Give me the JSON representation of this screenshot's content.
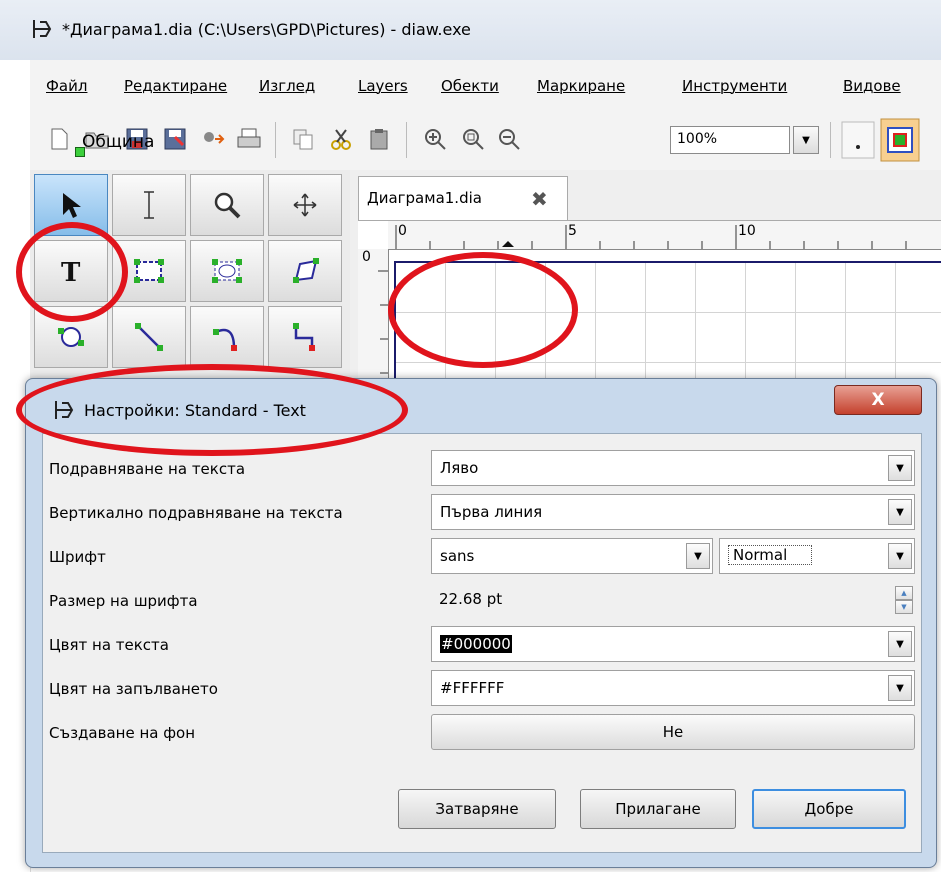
{
  "window": {
    "title": "*Диаграма1.dia (C:\\Users\\GPD\\Pictures) - diaw.exe"
  },
  "menu": [
    "Файл",
    "Редактиране",
    "Изглед",
    "Layers",
    "Обекти",
    "Маркиране",
    "Инструменти",
    "Видове"
  ],
  "toolbar": {
    "icons": [
      "new-file-icon",
      "open-folder-icon",
      "save-icon",
      "save-as-icon",
      "export-icon",
      "print-icon",
      "copy-icon",
      "cut-icon",
      "paste-icon",
      "zoom-in-icon",
      "zoom-fit-icon",
      "zoom-out-icon"
    ],
    "zoom_value": "100%"
  },
  "toolbox": {
    "tools": [
      "pointer-tool",
      "text-edit-tool",
      "magnify-tool",
      "move-tool",
      "text-tool",
      "box-tool",
      "ellipse-tool",
      "polygon-tool",
      "bezier-tool",
      "line-tool",
      "arc-tool",
      "zigzag-tool"
    ]
  },
  "document": {
    "tab_label": "Диаграма1.dia",
    "ruler_h": [
      "0",
      "5",
      "10"
    ],
    "ruler_v": [
      "0"
    ],
    "text_object": "Община"
  },
  "dialog": {
    "title": "Настройки: Standard - Text",
    "close_label": "X",
    "properties": [
      {
        "label": "Подравняване на текста",
        "value": "Ляво"
      },
      {
        "label": "Вертикално подравняване на текста",
        "value": "Първа линия"
      },
      {
        "label": "Шрифт",
        "value": "sans",
        "style": "Normal"
      },
      {
        "label": "Размер на шрифта",
        "value": "22.68 pt"
      },
      {
        "label": "Цвят на текста",
        "value": "#000000"
      },
      {
        "label": "Цвят на запълването",
        "value": "#FFFFFF"
      },
      {
        "label": "Създаване на фон",
        "value": "Не"
      }
    ],
    "buttons": {
      "close": "Затваряне",
      "apply": "Прилагане",
      "ok": "Добре"
    }
  },
  "colors": {
    "annotation_red": "#e0141c",
    "handle_green": "#3ccf3c",
    "dialog_frame": "#c8d9ec"
  }
}
